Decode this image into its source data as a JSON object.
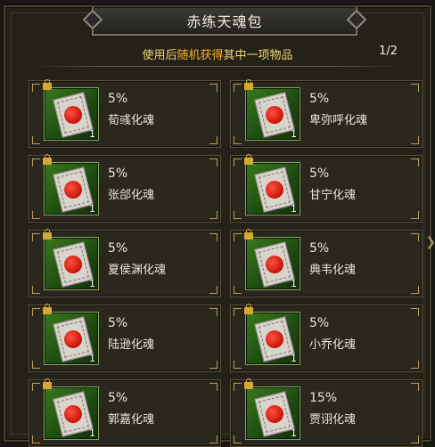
{
  "title": "赤练天魂包",
  "subtitle": {
    "prefix": "使用后",
    "highlight": "随机获得",
    "suffix": "其中一项物品"
  },
  "page": "1/2",
  "items": [
    {
      "pct": "5%",
      "name": "荀彧化魂",
      "qty": "1"
    },
    {
      "pct": "5%",
      "name": "卑弥呼化魂",
      "qty": "1"
    },
    {
      "pct": "5%",
      "name": "张郃化魂",
      "qty": "1"
    },
    {
      "pct": "5%",
      "name": "甘宁化魂",
      "qty": "1"
    },
    {
      "pct": "5%",
      "name": "夏侯渊化魂",
      "qty": "1"
    },
    {
      "pct": "5%",
      "name": "典韦化魂",
      "qty": "1"
    },
    {
      "pct": "5%",
      "name": "陆逊化魂",
      "qty": "1"
    },
    {
      "pct": "5%",
      "name": "小乔化魂",
      "qty": "1"
    },
    {
      "pct": "5%",
      "name": "郭嘉化魂",
      "qty": "1"
    },
    {
      "pct": "15%",
      "name": "贾诩化魂",
      "qty": "1"
    }
  ],
  "icons": {
    "item": "soul-talisman-icon",
    "lock": "lock-icon",
    "next": "chevron-right-icon"
  },
  "colors": {
    "highlight": "#ffb020",
    "subtitle": "#f0d878",
    "text": "#ebe6d6"
  }
}
